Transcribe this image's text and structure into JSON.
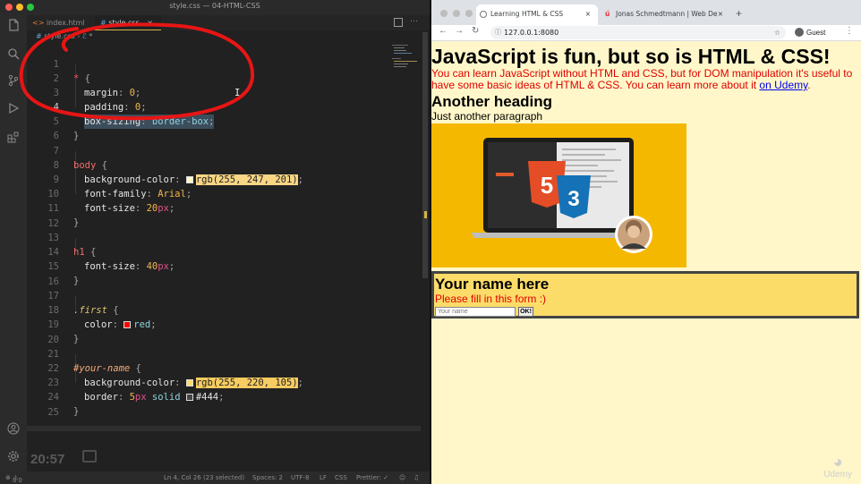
{
  "vscode": {
    "window_title": "style.css — 04-HTML-CSS",
    "tabs": [
      {
        "label": "index.html",
        "icon": "<>"
      },
      {
        "label": "style.css",
        "icon": "#"
      }
    ],
    "breadcrumb": {
      "file": "style.css",
      "symbol": "*"
    },
    "code": {
      "line_numbers": [
        "1",
        "2",
        "3",
        "4",
        "5",
        "6",
        "7",
        "8",
        "9",
        "10",
        "11",
        "12",
        "13",
        "14",
        "15",
        "16",
        "17",
        "18",
        "19",
        "20",
        "21",
        "22",
        "23",
        "24",
        "25"
      ],
      "l1_sel": "*",
      "l1_brace": "{",
      "l2_prop": "margin",
      "l2_val": "0",
      "l3_prop": "padding",
      "l3_val": "0",
      "l4_prop": "box-sizing",
      "l4_val": "border-box",
      "l5": "}",
      "l7_sel": "body",
      "l7_brace": "{",
      "l8_prop": "background-color",
      "l8_val": "rgb(255, 247, 201)",
      "l9_prop": "font-family",
      "l9_val": "Arial",
      "l10_prop": "font-size",
      "l10_num": "20",
      "l10_unit": "px",
      "l11": "}",
      "l13_sel": "h1",
      "l13_brace": "{",
      "l14_prop": "font-size",
      "l14_num": "40",
      "l14_unit": "px",
      "l15": "}",
      "l17_sel": ".first",
      "l17_brace": "{",
      "l18_prop": "color",
      "l18_val": "red",
      "l19": "}",
      "l21_sel": "#your-name",
      "l21_brace": "{",
      "l22_prop": "background-color",
      "l22_val": "rgb(255, 220, 105)",
      "l23_prop": "border",
      "l23_num": "5",
      "l23_unit": "px",
      "l23_kw": "solid",
      "l23_col": "#444",
      "l24": "}"
    },
    "swatches": {
      "body_bg": "#fff7c9",
      "first_color": "#ff0000",
      "yourname_bg": "#ffdc69",
      "border_col": "#444444"
    },
    "clock": "20:57",
    "status": {
      "errors": "0",
      "warnings": "0",
      "cursor": "Ln 4, Col 26 (23 selected)",
      "spaces": "Spaces: 2",
      "encoding": "UTF-8",
      "eol": "LF",
      "language": "CSS",
      "formatter": "Prettier: ✓"
    }
  },
  "browser": {
    "tabs": [
      {
        "label": "Learning HTML & CSS",
        "close": "×"
      },
      {
        "label": "Jonas Schmedtmann | Web De",
        "close": "×"
      }
    ],
    "new_tab": "+",
    "url": "127.0.0.1:8080",
    "profile": "Guest",
    "page": {
      "h1": "JavaScript is fun, but so is HTML & CSS!",
      "intro": "You can learn JavaScript without HTML and CSS, but for DOM manipulation it's useful to have some basic ideas of HTML & CSS. You can learn more about it ",
      "link": "on Udemy",
      "intro_end": ".",
      "h2": "Another heading",
      "para": "Just another paragraph",
      "form_title": "Your name here",
      "form_hint": "Please fill in this form :)",
      "input_placeholder": "Your name",
      "ok_button": "OK!"
    },
    "watermark": "Udemy"
  },
  "colors": {
    "annotation": "#e81515",
    "page_bg": "#fff7c9",
    "form_bg": "#fcdc69",
    "hero_bg": "#f5b800"
  }
}
